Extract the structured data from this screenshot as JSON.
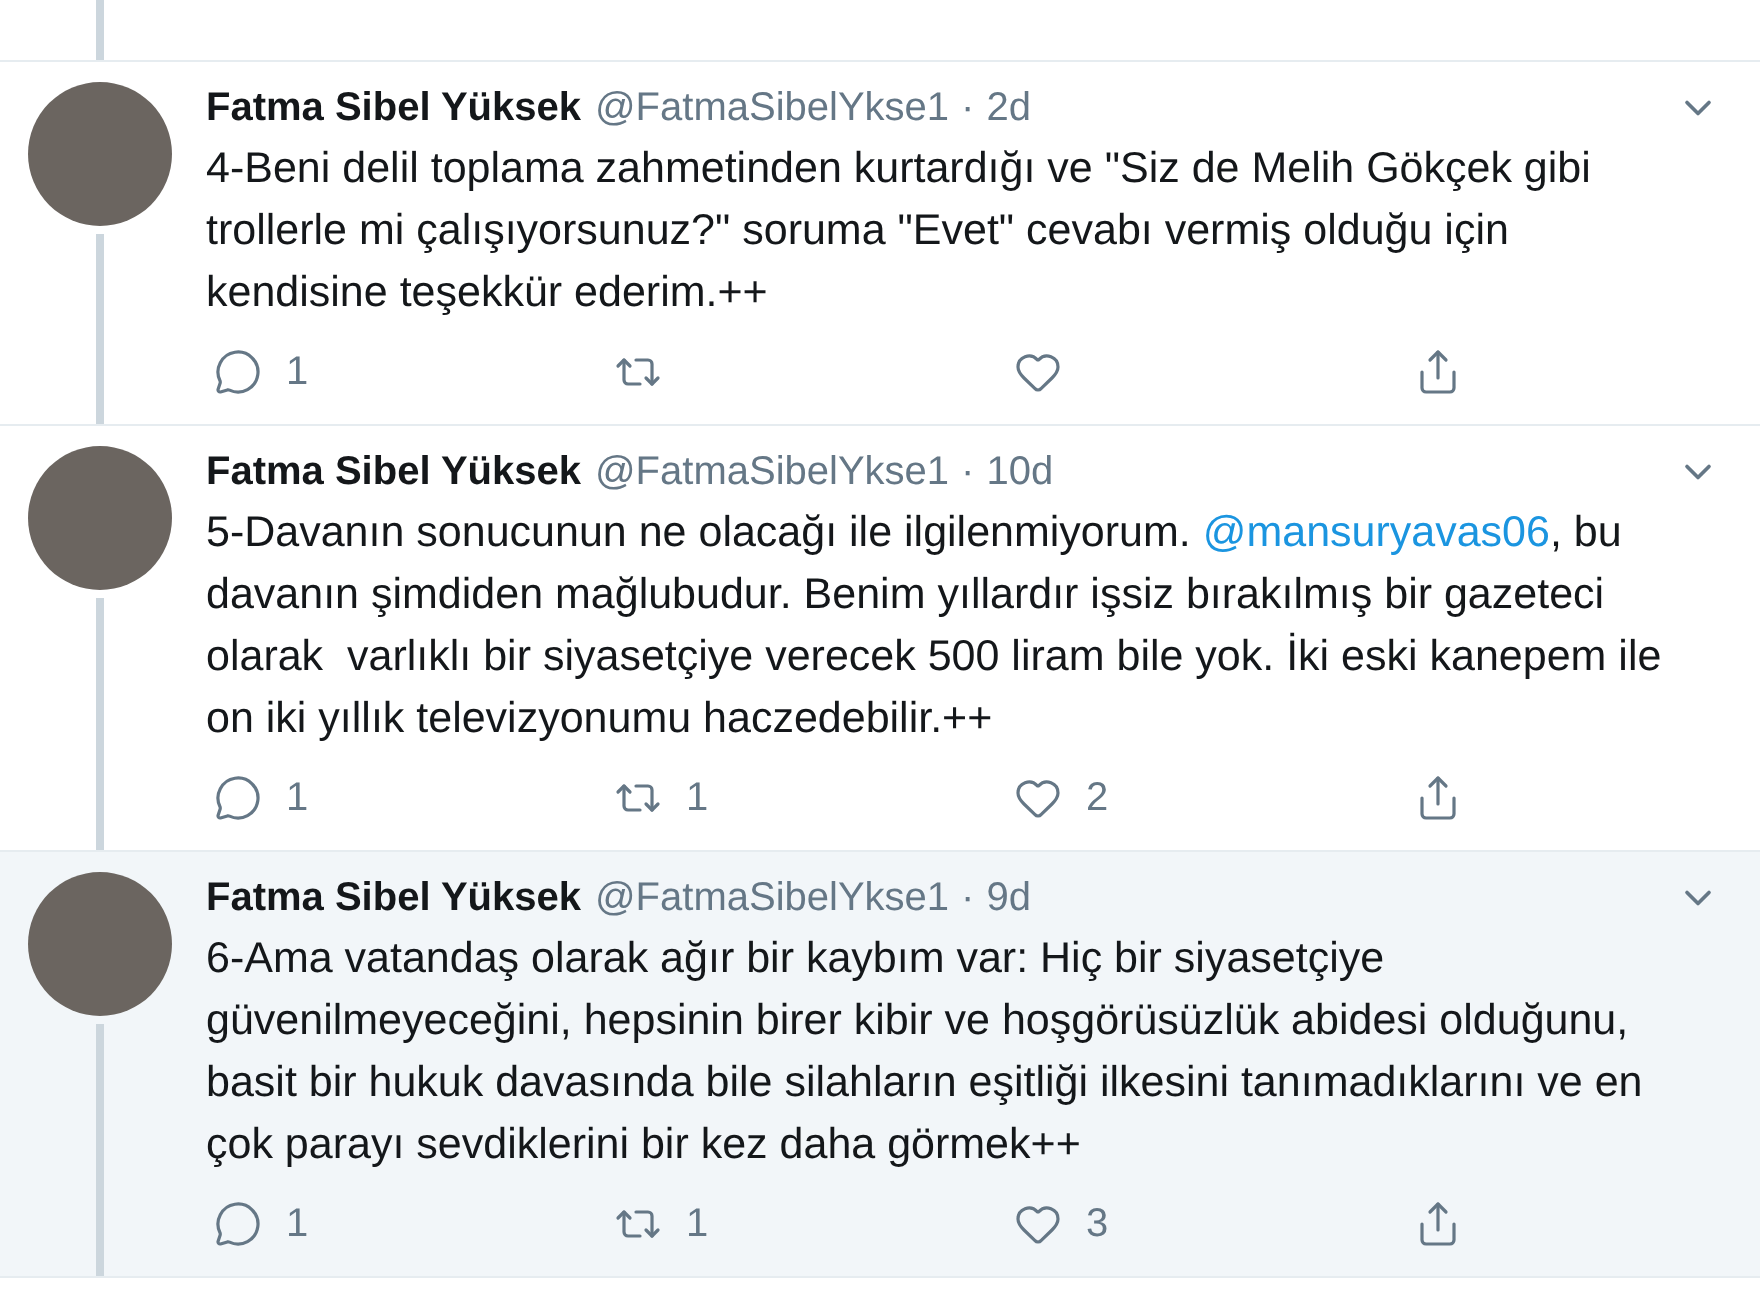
{
  "tweets": [
    {
      "name": "Fatma Sibel Yüksek",
      "handle": "@FatmaSibelYkse1",
      "separator": "·",
      "time": "2d",
      "highlighted": false,
      "text": [
        {
          "kind": "text",
          "value": "4-Beni delil toplama zahmetinden kurtardığı ve \"Siz de Melih Gökçek gibi trollerle mi çalışıyorsunuz?\" soruma \"Evet\" cevabı vermiş olduğu için kendisine teşekkür ederim.++"
        }
      ],
      "replies": "1"
    },
    {
      "name": "Fatma Sibel Yüksek",
      "handle": "@FatmaSibelYkse1",
      "separator": "·",
      "time": "10d",
      "highlighted": false,
      "text": [
        {
          "kind": "text",
          "value": "5-Davanın sonucunun ne olacağı ile ilgilenmiyorum. "
        },
        {
          "kind": "mention",
          "value": "@mansuryavas06"
        },
        {
          "kind": "text",
          "value": ", bu davanın şimdiden mağlubudur. Benim yıllardır işsiz bırakılmış bir gazeteci olarak  varlıklı bir siyasetçiye verecek 500 liram bile yok. İki eski kanepem ile on iki yıllık televizyonumu haczedebilir.++"
        }
      ],
      "replies": "1",
      "retweets": "1",
      "likes": "2"
    },
    {
      "name": "Fatma Sibel Yüksek",
      "handle": "@FatmaSibelYkse1",
      "separator": "·",
      "time": "9d",
      "highlighted": true,
      "text": [
        {
          "kind": "text",
          "value": "6-Ama vatandaş olarak ağır bir kaybım var: Hiç bir siyasetçiye güvenilmeyeceğini, hepsinin birer kibir ve hoşgörüsüzlük abidesi olduğunu, basit bir hukuk davasında bile silahların eşitliği ilkesini tanımadıklarını ve en çok parayı sevdiklerini bir kez daha görmek++"
        }
      ],
      "replies": "1",
      "retweets": "1",
      "likes": "3"
    }
  ]
}
